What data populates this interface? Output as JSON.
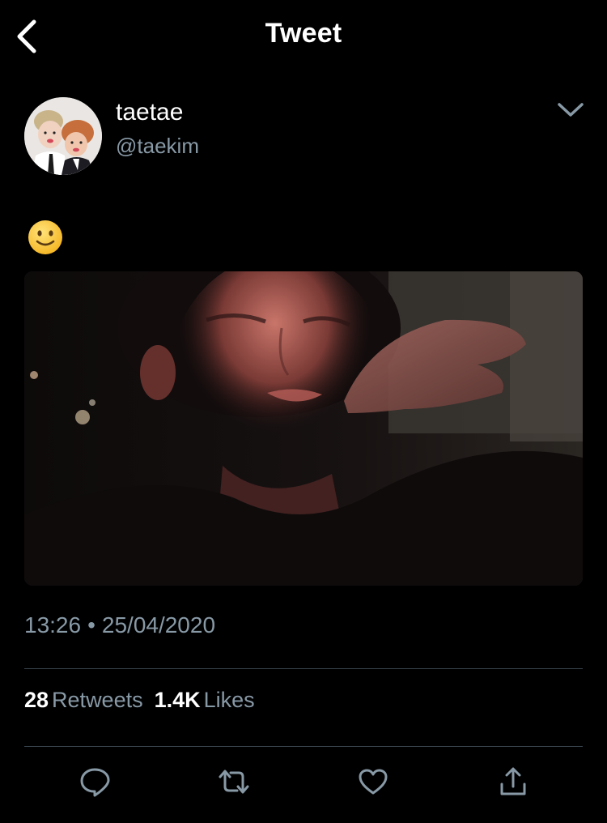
{
  "header": {
    "title": "Tweet",
    "back_icon": "chevron-left-icon"
  },
  "author": {
    "display_name": "taetae",
    "handle": "@taekim",
    "avatar_icon": "avatar",
    "menu_icon": "chevron-down-icon"
  },
  "tweet": {
    "text_emoji": "🙂",
    "media_description_icon": "tweet-photo",
    "time": "13:26",
    "separator": "•",
    "date": "25/04/2020"
  },
  "stats": {
    "retweets_count": "28",
    "retweets_label": "Retweets",
    "likes_count": "1.4K",
    "likes_label": "Likes"
  },
  "actions": {
    "reply_icon": "reply-icon",
    "retweet_icon": "retweet-icon",
    "like_icon": "heart-icon",
    "share_icon": "share-icon"
  },
  "colors": {
    "background": "#000000",
    "primary_text": "#ffffff",
    "secondary_text": "#8899a6",
    "divider": "#38444d",
    "icon": "#8899a6"
  }
}
